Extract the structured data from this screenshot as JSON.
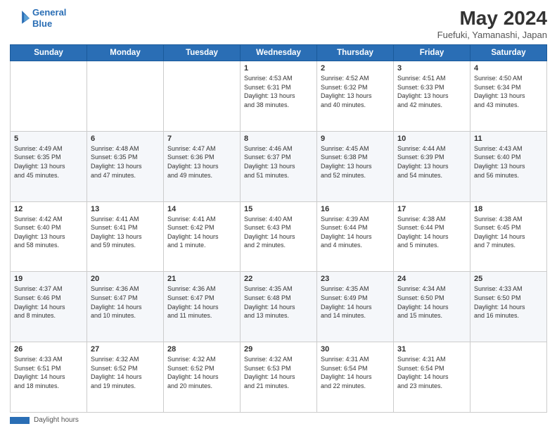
{
  "header": {
    "logo_line1": "General",
    "logo_line2": "Blue",
    "month_title": "May 2024",
    "location": "Fuefuki, Yamanashi, Japan"
  },
  "weekdays": [
    "Sunday",
    "Monday",
    "Tuesday",
    "Wednesday",
    "Thursday",
    "Friday",
    "Saturday"
  ],
  "footer_label": "Daylight hours",
  "weeks": [
    [
      {
        "day": "",
        "info": ""
      },
      {
        "day": "",
        "info": ""
      },
      {
        "day": "",
        "info": ""
      },
      {
        "day": "1",
        "info": "Sunrise: 4:53 AM\nSunset: 6:31 PM\nDaylight: 13 hours\nand 38 minutes."
      },
      {
        "day": "2",
        "info": "Sunrise: 4:52 AM\nSunset: 6:32 PM\nDaylight: 13 hours\nand 40 minutes."
      },
      {
        "day": "3",
        "info": "Sunrise: 4:51 AM\nSunset: 6:33 PM\nDaylight: 13 hours\nand 42 minutes."
      },
      {
        "day": "4",
        "info": "Sunrise: 4:50 AM\nSunset: 6:34 PM\nDaylight: 13 hours\nand 43 minutes."
      }
    ],
    [
      {
        "day": "5",
        "info": "Sunrise: 4:49 AM\nSunset: 6:35 PM\nDaylight: 13 hours\nand 45 minutes."
      },
      {
        "day": "6",
        "info": "Sunrise: 4:48 AM\nSunset: 6:35 PM\nDaylight: 13 hours\nand 47 minutes."
      },
      {
        "day": "7",
        "info": "Sunrise: 4:47 AM\nSunset: 6:36 PM\nDaylight: 13 hours\nand 49 minutes."
      },
      {
        "day": "8",
        "info": "Sunrise: 4:46 AM\nSunset: 6:37 PM\nDaylight: 13 hours\nand 51 minutes."
      },
      {
        "day": "9",
        "info": "Sunrise: 4:45 AM\nSunset: 6:38 PM\nDaylight: 13 hours\nand 52 minutes."
      },
      {
        "day": "10",
        "info": "Sunrise: 4:44 AM\nSunset: 6:39 PM\nDaylight: 13 hours\nand 54 minutes."
      },
      {
        "day": "11",
        "info": "Sunrise: 4:43 AM\nSunset: 6:40 PM\nDaylight: 13 hours\nand 56 minutes."
      }
    ],
    [
      {
        "day": "12",
        "info": "Sunrise: 4:42 AM\nSunset: 6:40 PM\nDaylight: 13 hours\nand 58 minutes."
      },
      {
        "day": "13",
        "info": "Sunrise: 4:41 AM\nSunset: 6:41 PM\nDaylight: 13 hours\nand 59 minutes."
      },
      {
        "day": "14",
        "info": "Sunrise: 4:41 AM\nSunset: 6:42 PM\nDaylight: 14 hours\nand 1 minute."
      },
      {
        "day": "15",
        "info": "Sunrise: 4:40 AM\nSunset: 6:43 PM\nDaylight: 14 hours\nand 2 minutes."
      },
      {
        "day": "16",
        "info": "Sunrise: 4:39 AM\nSunset: 6:44 PM\nDaylight: 14 hours\nand 4 minutes."
      },
      {
        "day": "17",
        "info": "Sunrise: 4:38 AM\nSunset: 6:44 PM\nDaylight: 14 hours\nand 5 minutes."
      },
      {
        "day": "18",
        "info": "Sunrise: 4:38 AM\nSunset: 6:45 PM\nDaylight: 14 hours\nand 7 minutes."
      }
    ],
    [
      {
        "day": "19",
        "info": "Sunrise: 4:37 AM\nSunset: 6:46 PM\nDaylight: 14 hours\nand 8 minutes."
      },
      {
        "day": "20",
        "info": "Sunrise: 4:36 AM\nSunset: 6:47 PM\nDaylight: 14 hours\nand 10 minutes."
      },
      {
        "day": "21",
        "info": "Sunrise: 4:36 AM\nSunset: 6:47 PM\nDaylight: 14 hours\nand 11 minutes."
      },
      {
        "day": "22",
        "info": "Sunrise: 4:35 AM\nSunset: 6:48 PM\nDaylight: 14 hours\nand 13 minutes."
      },
      {
        "day": "23",
        "info": "Sunrise: 4:35 AM\nSunset: 6:49 PM\nDaylight: 14 hours\nand 14 minutes."
      },
      {
        "day": "24",
        "info": "Sunrise: 4:34 AM\nSunset: 6:50 PM\nDaylight: 14 hours\nand 15 minutes."
      },
      {
        "day": "25",
        "info": "Sunrise: 4:33 AM\nSunset: 6:50 PM\nDaylight: 14 hours\nand 16 minutes."
      }
    ],
    [
      {
        "day": "26",
        "info": "Sunrise: 4:33 AM\nSunset: 6:51 PM\nDaylight: 14 hours\nand 18 minutes."
      },
      {
        "day": "27",
        "info": "Sunrise: 4:32 AM\nSunset: 6:52 PM\nDaylight: 14 hours\nand 19 minutes."
      },
      {
        "day": "28",
        "info": "Sunrise: 4:32 AM\nSunset: 6:52 PM\nDaylight: 14 hours\nand 20 minutes."
      },
      {
        "day": "29",
        "info": "Sunrise: 4:32 AM\nSunset: 6:53 PM\nDaylight: 14 hours\nand 21 minutes."
      },
      {
        "day": "30",
        "info": "Sunrise: 4:31 AM\nSunset: 6:54 PM\nDaylight: 14 hours\nand 22 minutes."
      },
      {
        "day": "31",
        "info": "Sunrise: 4:31 AM\nSunset: 6:54 PM\nDaylight: 14 hours\nand 23 minutes."
      },
      {
        "day": "",
        "info": ""
      }
    ]
  ]
}
